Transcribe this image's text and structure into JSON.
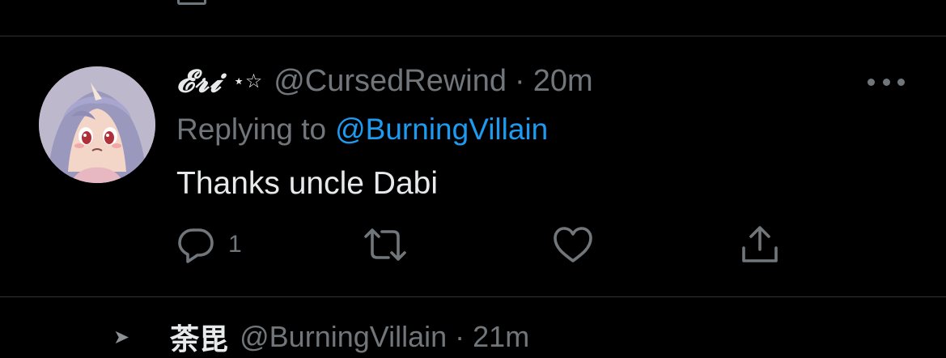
{
  "tweet": {
    "display_name": "𝓔𝓻𝓲",
    "name_decoration": "⋆☆",
    "handle": "@CursedRewind",
    "separator": "·",
    "time": "20m",
    "replying_prefix": "Replying to",
    "replying_to": "@BurningVillain",
    "text": "Thanks uncle Dabi",
    "reply_count": "1"
  },
  "icons": {
    "more": "more-horizontal-icon",
    "reply": "comment-bubble-icon",
    "retweet": "retweet-icon",
    "like": "heart-icon",
    "share": "share-upload-icon"
  },
  "next_tweet": {
    "display_name": "荼毘",
    "handle": "@BurningVillain",
    "separator": "·",
    "time": "21m"
  },
  "colors": {
    "background": "#000000",
    "text": "#e7e9ea",
    "muted": "#71767b",
    "link": "#1d9bf0",
    "divider": "#2f3336"
  }
}
